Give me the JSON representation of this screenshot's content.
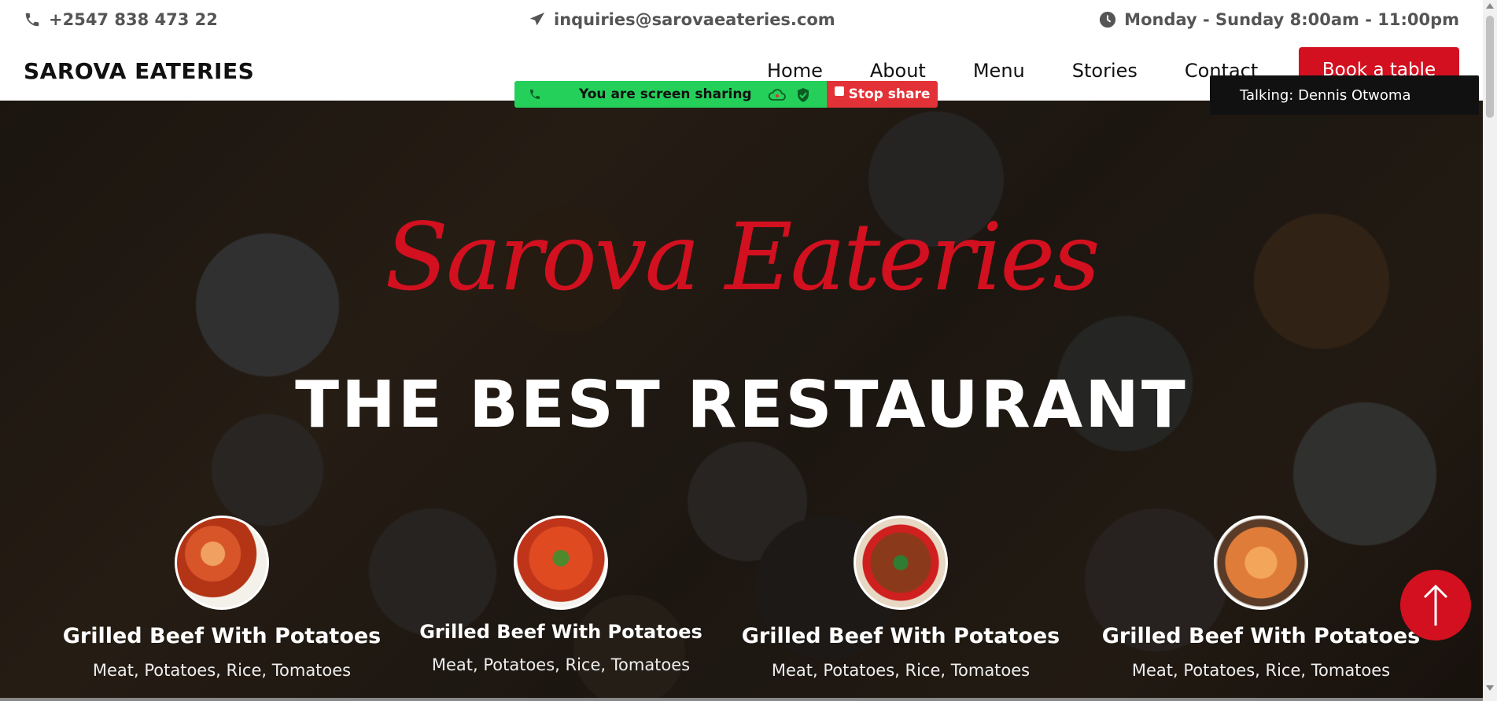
{
  "topbar": {
    "phone": "+2547 838 473 22",
    "email": "inquiries@sarovaeateries.com",
    "hours": "Monday - Sunday 8:00am - 11:00pm"
  },
  "nav": {
    "brand": "SAROVA EATERIES",
    "links": [
      "Home",
      "About",
      "Menu",
      "Stories",
      "Contact"
    ],
    "cta": "Book a table"
  },
  "hero": {
    "script_title": "Sarova Eateries",
    "headline": "THE BEST RESTAURANT",
    "dishes": [
      {
        "name": "Grilled Beef With Potatoes",
        "ingredients": "Meat, Potatoes, Rice, Tomatoes"
      },
      {
        "name": "Grilled Beef With Potatoes",
        "ingredients": "Meat, Potatoes, Rice, Tomatoes"
      },
      {
        "name": "Grilled Beef With Potatoes",
        "ingredients": "Meat, Potatoes, Rice, Tomatoes"
      },
      {
        "name": "Grilled Beef With Potatoes",
        "ingredients": "Meat, Potatoes, Rice, Tomatoes"
      }
    ]
  },
  "screen_share": {
    "status": "You are screen sharing",
    "stop_label": "Stop share",
    "talking": "Talking: Dennis Otwoma"
  },
  "colors": {
    "accent": "#d2101f",
    "share_green": "#25d05a",
    "share_red": "#e23237"
  },
  "icons": [
    "phone-icon",
    "paper-plane-icon",
    "clock-icon",
    "arrow-up-icon",
    "cloud-icon",
    "shield-check-icon"
  ]
}
